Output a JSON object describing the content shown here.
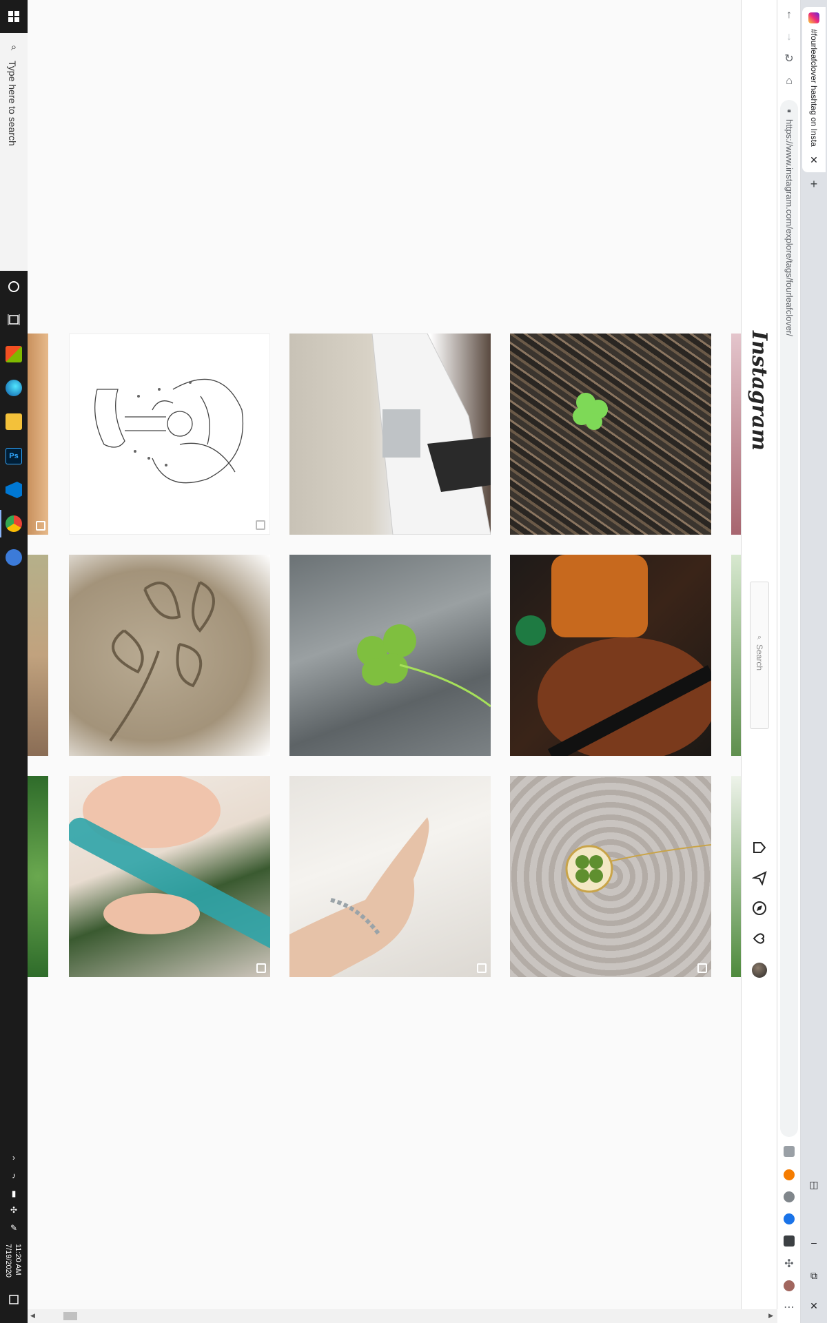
{
  "taskbar": {
    "search_placeholder": "Type here to search",
    "clock_time": "11:20 AM",
    "clock_date": "7/19/2020",
    "pinned_icons": [
      "cortana-icon",
      "task-view-icon",
      "microsoft-store-icon",
      "edge-icon",
      "file-explorer-icon",
      "photoshop-icon",
      "vscode-icon",
      "chrome-icon",
      "settings-icon"
    ],
    "photoshop_label": "Ps"
  },
  "browser": {
    "tab_title": "#fourleafclover hashtag on Insta",
    "url": "https://www.instagram.com/explore/tags/fourleafclover/",
    "new_tab_label": "+",
    "tab_close_label": "✕"
  },
  "instagram": {
    "logo": "Instagram",
    "search_placeholder": "Search",
    "nav_icons": [
      "home-icon",
      "direct-icon",
      "explore-icon",
      "activity-icon",
      "profile-avatar"
    ]
  },
  "grid": {
    "rows": [
      [
        {
          "name": "sketch-drawing-post",
          "desc_icon": "gallery-badge-icon"
        },
        {
          "name": "sneaker-anklet-post",
          "desc_icon": ""
        },
        {
          "name": "clover-mulch-post",
          "desc_icon": ""
        }
      ],
      [
        {
          "name": "sand-clover-post",
          "desc_icon": ""
        },
        {
          "name": "clover-water-post",
          "desc_icon": ""
        },
        {
          "name": "violin-tea-post",
          "desc_icon": ""
        }
      ],
      [
        {
          "name": "resin-tube-post",
          "desc_icon": "gallery-badge-icon"
        },
        {
          "name": "bracelet-hand-post",
          "desc_icon": "gallery-badge-icon"
        },
        {
          "name": "clover-necklace-post",
          "desc_icon": "gallery-badge-icon"
        }
      ]
    ]
  },
  "colors": {
    "taskbar_bg": "#1b1b1b",
    "page_bg": "#fafafa",
    "ig_text": "#262626",
    "chrome_bg": "#dee1e6"
  }
}
